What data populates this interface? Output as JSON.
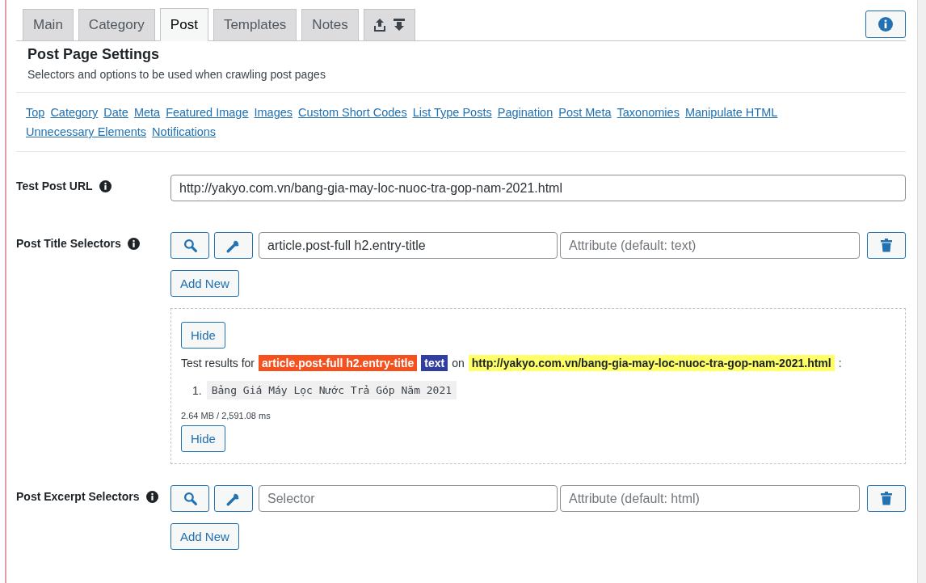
{
  "tabs": [
    {
      "kind": "text",
      "label": "Main",
      "selected": false
    },
    {
      "kind": "text",
      "label": "Category",
      "selected": false
    },
    {
      "kind": "text",
      "label": "Post",
      "selected": true
    },
    {
      "kind": "text",
      "label": "Templates",
      "selected": false
    },
    {
      "kind": "text",
      "label": "Notes",
      "selected": false
    },
    {
      "kind": "icons",
      "selected": false
    }
  ],
  "section": {
    "title": "Post Page Settings",
    "description": "Selectors and options to be used when crawling post pages"
  },
  "nav_links": [
    "Top",
    "Category",
    "Date",
    "Meta",
    "Featured Image",
    "Images",
    "Custom Short Codes",
    "List Type Posts",
    "Pagination",
    "Post Meta",
    "Taxonomies",
    "Manipulate HTML",
    "Unnecessary Elements",
    "Notifications"
  ],
  "test_post_url": {
    "label": "Test Post URL",
    "value": "http://yakyo.com.vn/bang-gia-may-loc-nuoc-tra-gop-nam-2021.html"
  },
  "selector_groups": [
    {
      "label": "Post Title Selectors",
      "selector": {
        "value": "article.post-full h2.entry-title"
      },
      "attribute": {
        "placeholder": "Attribute (default: text)"
      },
      "add_button": "Add New",
      "results": {
        "hide_button": "Hide",
        "prefix": "Test results for",
        "selector": "article.post-full h2.entry-title",
        "attribute": "text",
        "joiner": "on",
        "url": "http://yakyo.com.vn/bang-gia-may-loc-nuoc-tra-gop-nam-2021.html",
        "suffix": ":",
        "items": [
          {
            "number": "1.",
            "text": "Bảng Giá Máy Lọc Nước Trả Góp Năm 2021"
          }
        ],
        "stats": "2.64 MB / 2,591.08 ms",
        "hide_button_bottom": "Hide"
      }
    },
    {
      "label": "Post Excerpt Selectors",
      "selector": {
        "placeholder": "Selector"
      },
      "attribute": {
        "placeholder": "Attribute (default: html)"
      },
      "add_button": "Add New"
    }
  ]
}
